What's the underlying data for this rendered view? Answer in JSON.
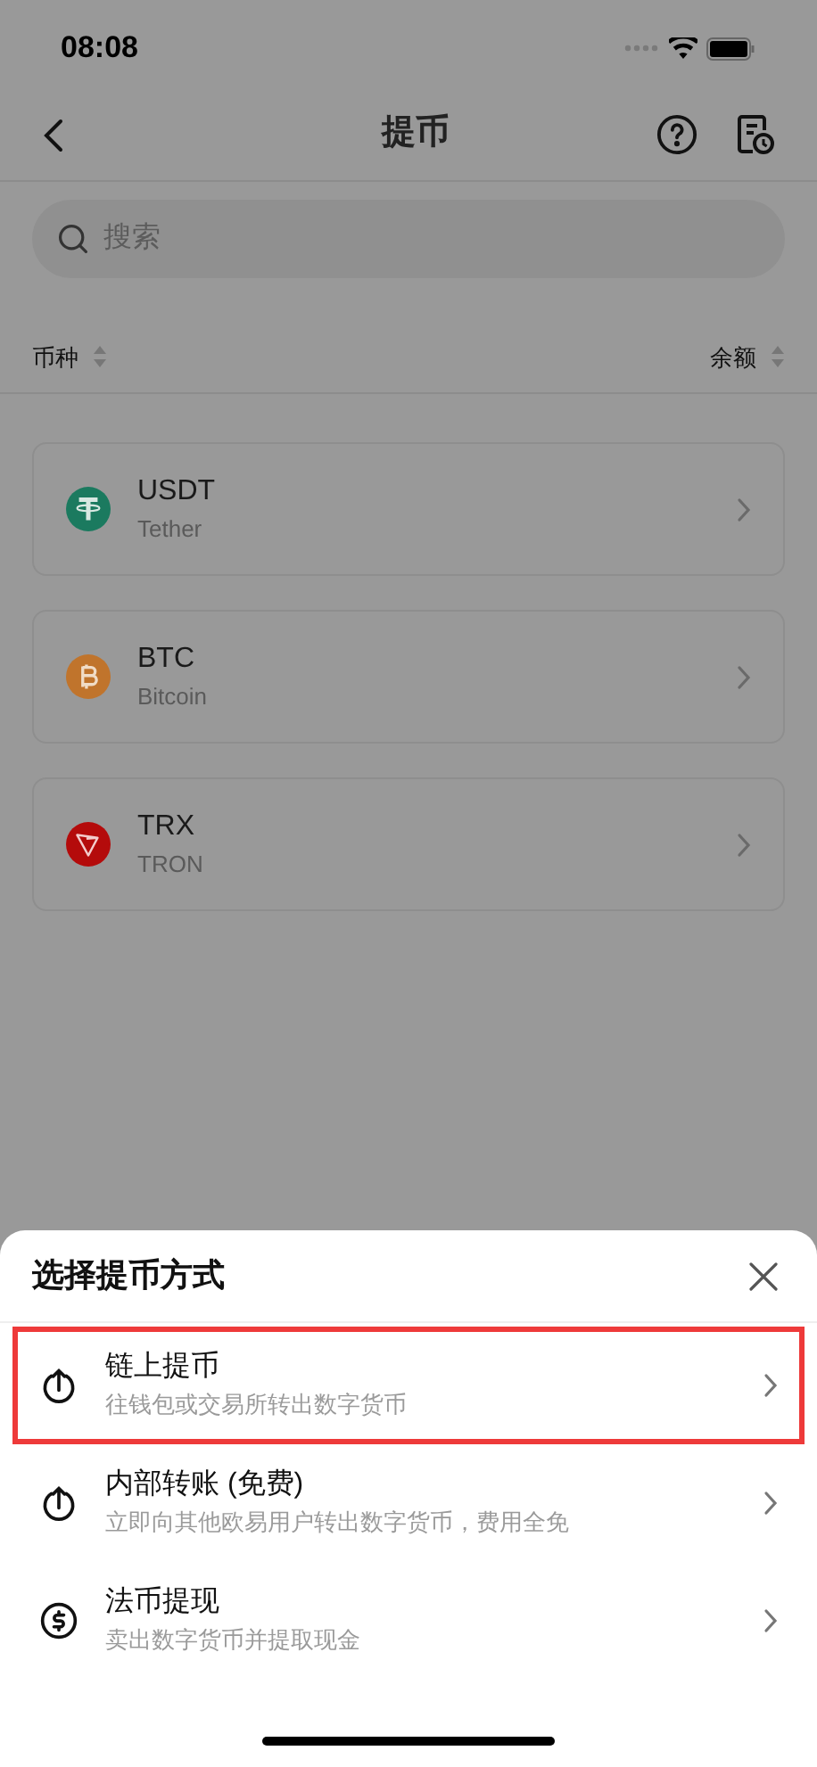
{
  "status_bar": {
    "time": "08:08"
  },
  "nav": {
    "title": "提币"
  },
  "search": {
    "placeholder": "搜索"
  },
  "list_header": {
    "left": "币种",
    "right": "余额"
  },
  "coins": [
    {
      "symbol": "USDT",
      "name": "Tether",
      "kind": "tether",
      "color": "#1b7a5f"
    },
    {
      "symbol": "BTC",
      "name": "Bitcoin",
      "kind": "bitcoin",
      "color": "#c0742c"
    },
    {
      "symbol": "TRX",
      "name": "TRON",
      "kind": "tron",
      "color": "#b40b0b"
    }
  ],
  "sheet": {
    "title": "选择提币方式",
    "options": [
      {
        "title": "链上提币",
        "subtitle": "往钱包或交易所转出数字货币",
        "kind": "upload",
        "selected": true
      },
      {
        "title": "内部转账 (免费)",
        "subtitle": "立即向其他欧易用户转出数字货币，费用全免",
        "kind": "upload",
        "selected": false
      },
      {
        "title": "法币提现",
        "subtitle": "卖出数字货币并提取现金",
        "kind": "dollar",
        "selected": false
      }
    ]
  }
}
